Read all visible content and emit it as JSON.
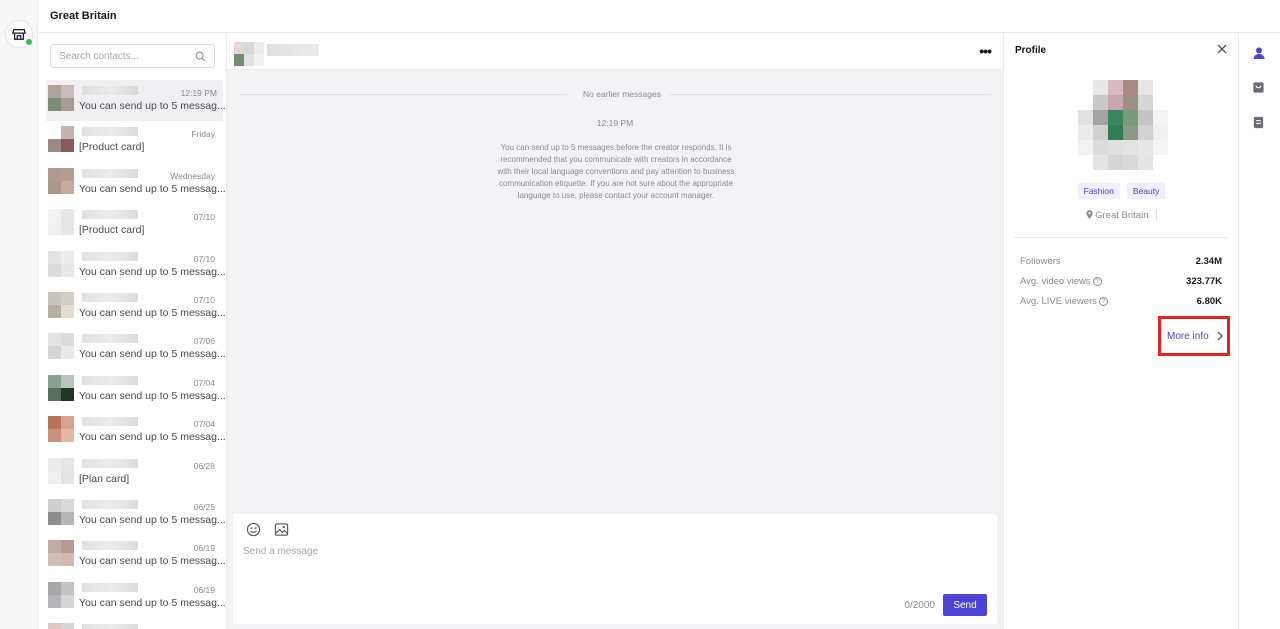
{
  "header": {
    "title": "Great Britain"
  },
  "search": {
    "placeholder": "Search contacts..."
  },
  "contacts": [
    {
      "time": "12:19 PM",
      "preview": "You can send up to 5 messag...",
      "colors": [
        "#b0a19a",
        "#c9bcb8",
        "#7a8e74",
        "#a59c95"
      ],
      "active": true
    },
    {
      "time": "Friday",
      "preview": "[Product card]",
      "colors": [
        "#ffffff",
        "#c7b3ad",
        "#9c8a86",
        "#8a5a5b"
      ]
    },
    {
      "time": "Wednesday",
      "preview": "You can send up to 5 messag...",
      "colors": [
        "#b09a8e",
        "#b69c8c",
        "#ae968c",
        "#c8a898"
      ]
    },
    {
      "time": "07/10",
      "preview": "[Product card]",
      "colors": [
        "#f2f2f2",
        "#e7e7e7",
        "#f0f0f0",
        "#e6e6e6"
      ]
    },
    {
      "time": "07/10",
      "preview": "You can send up to 5 messag...",
      "colors": [
        "#e3e3e3",
        "#ececec",
        "#dcdcdc",
        "#e8e8e8"
      ]
    },
    {
      "time": "07/10",
      "preview": "You can send up to 5 messag...",
      "colors": [
        "#cac5bc",
        "#d3cfc8",
        "#b8b09f",
        "#e3dcd0"
      ]
    },
    {
      "time": "07/06",
      "preview": "You can send up to 5 messag...",
      "colors": [
        "#e3e3e3",
        "#dcdcdc",
        "#d6d6d6",
        "#e8e8e8"
      ]
    },
    {
      "time": "07/04",
      "preview": "You can send up to 5 messag...",
      "colors": [
        "#8aa090",
        "#b8c4bc",
        "#566e5e",
        "#203428"
      ]
    },
    {
      "time": "07/04",
      "preview": "You can send up to 5 messag...",
      "colors": [
        "#b97258",
        "#d8a28c",
        "#c8927a",
        "#e2b8a4"
      ]
    },
    {
      "time": "06/28",
      "preview": "[Plan card]",
      "colors": [
        "#ececec",
        "#e6e6e6",
        "#f0f0f0",
        "#e4e4e4"
      ]
    },
    {
      "time": "06/25",
      "preview": "You can send up to 5 messag...",
      "colors": [
        "#cfcfcf",
        "#dadada",
        "#8d8e8e",
        "#b5b5b5"
      ]
    },
    {
      "time": "06/19",
      "preview": "You can send up to 5 messag...",
      "colors": [
        "#c4aaa4",
        "#b69a93",
        "#d4bcb6",
        "#d1b8b2"
      ]
    },
    {
      "time": "06/19",
      "preview": "You can send up to 5 messag...",
      "colors": [
        "#a8a8aa",
        "#c4c4c6",
        "#b5b5b8",
        "#d6d6d8"
      ]
    },
    {
      "time": "",
      "preview": "",
      "colors": [
        "#e2c8c0",
        "#d6d6d6",
        "#ececec",
        "#e4e4e4"
      ]
    }
  ],
  "chat": {
    "no_earlier": "No earlier messages",
    "time": "12:19 PM",
    "notice": "You can send up to 5 messages before the creator responds. It is recommended that you communicate with creators in accordance with their local language conventions and pay attention to business communication etiquette. If you are not sure about the appropriate language to use, please contact your account manager.",
    "input_placeholder": "Send a message",
    "counter": "0/2000",
    "send_label": "Send",
    "more_icon": "ellipsis-icon"
  },
  "profile": {
    "title": "Profile",
    "tags": [
      "Fashion",
      "Beauty"
    ],
    "location": "Great Britain",
    "stats": [
      {
        "label": "Followers",
        "value": "2.34M",
        "help": false
      },
      {
        "label": "Avg. video views",
        "value": "323.77K",
        "help": true
      },
      {
        "label": "Avg. LIVE viewers",
        "value": "6.80K",
        "help": true
      }
    ],
    "more_info_label": "More info"
  },
  "colors": {
    "accent": "#4b44d6",
    "highlight_border": "#e8221a",
    "online": "#2bc54a"
  }
}
